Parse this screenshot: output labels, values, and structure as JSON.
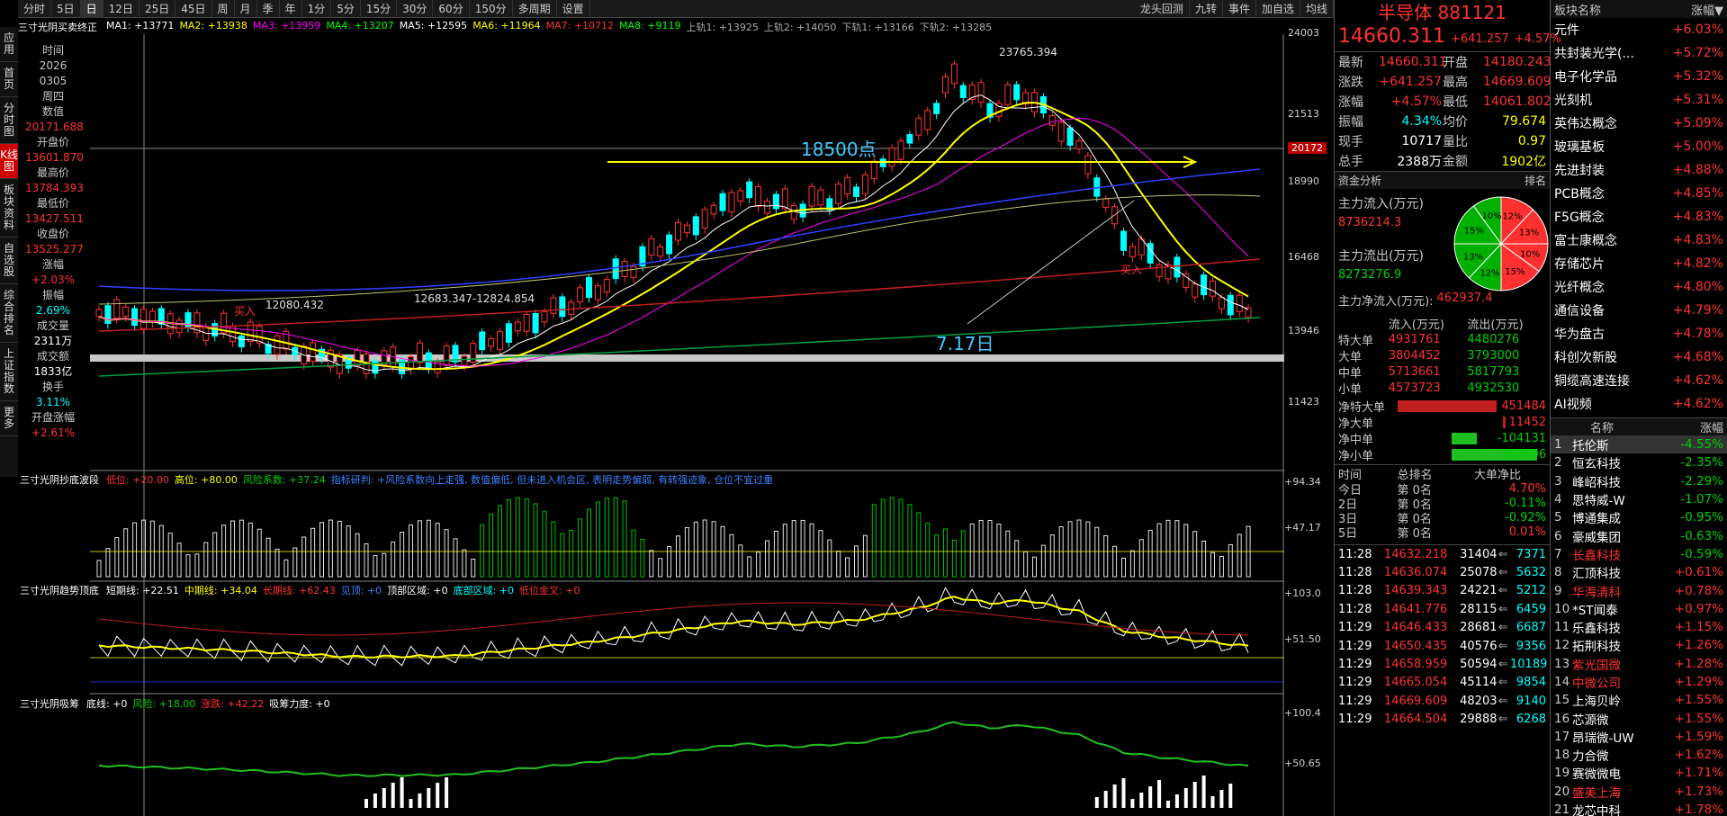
{
  "toolbar": {
    "periods": [
      "分时",
      "5日",
      "日",
      "12日",
      "25日",
      "45日",
      "周",
      "月",
      "季",
      "年",
      "1分",
      "5分",
      "15分",
      "30分",
      "60分",
      "150分",
      "多周期",
      "设置"
    ],
    "active": "日",
    "right_tools": [
      "龙头回测",
      "九转",
      "事件",
      "加自选",
      "均线"
    ]
  },
  "left_nav": [
    "应用",
    "首页",
    "分时图",
    "K线图",
    "板块资料",
    "自选股",
    "综合排名",
    "上证指数",
    "更多"
  ],
  "indicator_title": "三寸光阴买卖终正",
  "ma_labels": [
    {
      "t": "MA1: +13771",
      "c": "#ffffff"
    },
    {
      "t": "MA2: +13938",
      "c": "#ffff00"
    },
    {
      "t": "MA3: +13959",
      "c": "#ff00ff"
    },
    {
      "t": "MA4: +13207",
      "c": "#00ff00"
    },
    {
      "t": "MA5: +12595",
      "c": "#ffffff"
    },
    {
      "t": "MA6: +11964",
      "c": "#ffff00"
    },
    {
      "t": "MA7: +10712",
      "c": "#ff3232"
    },
    {
      "t": "MA8: +9119",
      "c": "#00ff00"
    },
    {
      "t": "上轨1: +13925",
      "c": "#aaaaaa"
    },
    {
      "t": "上轨2: +14050",
      "c": "#aaaaaa"
    },
    {
      "t": "下轨1: +13166",
      "c": "#aaaaaa"
    },
    {
      "t": "下轨2: +13285",
      "c": "#aaaaaa"
    }
  ],
  "info_panel": [
    {
      "k": "时间",
      "v": "2026"
    },
    {
      "k": "",
      "v": "0305"
    },
    {
      "k": "",
      "v": "周四"
    },
    {
      "k": "数值",
      "v": "20171.688",
      "c": "red"
    },
    {
      "k": "开盘价",
      "v": "13601.870",
      "c": "red"
    },
    {
      "k": "最高价",
      "v": "13784.393",
      "c": "red"
    },
    {
      "k": "最低价",
      "v": "13427.511",
      "c": "red"
    },
    {
      "k": "收盘价",
      "v": "13525.277",
      "c": "red"
    },
    {
      "k": "涨幅",
      "v": "+2.03%",
      "c": "red"
    },
    {
      "k": "振幅",
      "v": "2.69%",
      "c": "cyan"
    },
    {
      "k": "成交量",
      "v": "2311万",
      "c": "white"
    },
    {
      "k": "成交额",
      "v": "1833亿",
      "c": "white"
    },
    {
      "k": "换手",
      "v": "3.11%",
      "c": "cyan"
    },
    {
      "k": "开盘涨幅",
      "v": "+2.61%",
      "c": "red"
    }
  ],
  "main_axis": [
    "24003",
    "21513",
    "20172",
    "18990",
    "16468",
    "13946",
    "11423"
  ],
  "annotations": {
    "level": "18500点",
    "date": "7.17日",
    "high": "23765.394",
    "low": "12080.432",
    "low2": "12683.347-12824.854",
    "buy": "买入"
  },
  "sub1": {
    "title": "三寸光阴抄底波段",
    "items": [
      {
        "t": "低位: +20.00",
        "c": "#ff3232"
      },
      {
        "t": "高位: +80.00",
        "c": "#ffff00"
      },
      {
        "t": "风险系数: +37.24",
        "c": "#00d000"
      },
      {
        "t": "指标研判: +风险系数向上走强, 数值偏低, 但未进入机会区, 表明走势偏弱, 有转强迹象, 仓位不宜过重",
        "c": "#4080ff"
      }
    ],
    "axis": [
      "+94.34",
      "+47.17"
    ]
  },
  "sub2": {
    "title": "三寸光阴趋势顶底",
    "items": [
      {
        "t": "短期线: +22.51",
        "c": "#ffffff"
      },
      {
        "t": "中期线: +34.04",
        "c": "#ffff00"
      },
      {
        "t": "长期线: +62.43",
        "c": "#ff3232"
      },
      {
        "t": "见顶: +0",
        "c": "#4080ff"
      },
      {
        "t": "顶部区域: +0",
        "c": "#ffffff"
      },
      {
        "t": "底部区域: +0",
        "c": "#00ffff"
      },
      {
        "t": "低位金叉: +0",
        "c": "#ff3232"
      }
    ],
    "axis": [
      "+103.0",
      "+51.50"
    ]
  },
  "sub3": {
    "title": "三寸光阴吸筹",
    "items": [
      {
        "t": "底线: +0",
        "c": "#ffffff"
      },
      {
        "t": "风险: +18.00",
        "c": "#00d000"
      },
      {
        "t": "涨跌: +42.22",
        "c": "#ff3232"
      },
      {
        "t": "吸筹力度: +0",
        "c": "#ffffff"
      }
    ],
    "axis": [
      "+100.4",
      "+50.65"
    ]
  },
  "quote": {
    "name": "半导体 881121",
    "price": "14660.311",
    "chg": "+641.257",
    "pct": "+4.57%",
    "rows": [
      [
        "最新",
        "14660.311",
        "开盘",
        "14180.243"
      ],
      [
        "涨跌",
        "+641.257",
        "最高",
        "14669.609"
      ],
      [
        "涨幅",
        "+4.57%",
        "最低",
        "14061.802"
      ],
      [
        "振幅",
        "4.34%",
        "均价",
        "79.674"
      ],
      [
        "现手",
        "10717",
        "量比",
        "0.97"
      ],
      [
        "总手",
        "2388万",
        "金额",
        "1902亿"
      ]
    ]
  },
  "fund": {
    "title": "资金分析",
    "rank": "排名",
    "in_label": "主力流入(万元)",
    "in_val": "8736214.3",
    "out_label": "主力流出(万元)",
    "out_val": "8273276.9",
    "net_label": "主力净流入(万元):",
    "net_val": "462937.4",
    "pie": [
      {
        "v": "12%",
        "c": "#ff3030"
      },
      {
        "v": "13%",
        "c": "#ff3030"
      },
      {
        "v": "10%",
        "c": "#ff3030"
      },
      {
        "v": "15%",
        "c": "#ff3030"
      },
      {
        "v": "12%",
        "c": "#00b000"
      },
      {
        "v": "13%",
        "c": "#00b000"
      },
      {
        "v": "15%",
        "c": "#00b000"
      },
      {
        "v": "10%",
        "c": "#00b000"
      }
    ],
    "hdr": [
      "流入(万元)",
      "流出(万元)"
    ],
    "orders": [
      [
        "特大单",
        "4931761",
        "4480276"
      ],
      [
        "大单",
        "3804452",
        "3793000"
      ],
      [
        "中单",
        "5713661",
        "5817793"
      ],
      [
        "小单",
        "4573723",
        "4932530"
      ]
    ],
    "net": [
      [
        "净特大单",
        "451484"
      ],
      [
        "净大单",
        "11452"
      ],
      [
        "净中单",
        "-104131"
      ],
      [
        "净小单",
        "-358806"
      ]
    ],
    "rank_hdr": [
      "时间",
      "总排名",
      "大单净比"
    ],
    "ranks": [
      [
        "今日",
        "第 0名",
        "4.70%"
      ],
      [
        "2日",
        "第 0名",
        "-0.11%"
      ],
      [
        "3日",
        "第 0名",
        "-0.92%"
      ],
      [
        "5日",
        "第 0名",
        "0.01%"
      ]
    ]
  },
  "ticks": [
    [
      "11:28",
      "14632.218",
      "31404",
      "7371"
    ],
    [
      "11:28",
      "14636.074",
      "25078",
      "5632"
    ],
    [
      "11:28",
      "14639.343",
      "24221",
      "5212"
    ],
    [
      "11:28",
      "14641.776",
      "28115",
      "6459"
    ],
    [
      "11:29",
      "14646.433",
      "28681",
      "6687"
    ],
    [
      "11:29",
      "14650.435",
      "40576",
      "9356"
    ],
    [
      "11:29",
      "14658.959",
      "50594",
      "10189"
    ],
    [
      "11:29",
      "14665.054",
      "45114",
      "9854"
    ],
    [
      "11:29",
      "14669.609",
      "48203",
      "9140"
    ],
    [
      "11:29",
      "14664.504",
      "29888",
      "6268"
    ]
  ],
  "sectors": {
    "hdr": [
      "板块名称",
      "涨幅▼"
    ],
    "rows": [
      [
        "元件",
        "+6.03%"
      ],
      [
        "共封装光学(...",
        "+5.72%"
      ],
      [
        "电子化学品",
        "+5.32%"
      ],
      [
        "光刻机",
        "+5.31%"
      ],
      [
        "英伟达概念",
        "+5.09%"
      ],
      [
        "玻璃基板",
        "+5.00%"
      ],
      [
        "先进封装",
        "+4.88%"
      ],
      [
        "PCB概念",
        "+4.85%"
      ],
      [
        "F5G概念",
        "+4.83%"
      ],
      [
        "富士康概念",
        "+4.83%"
      ],
      [
        "存储芯片",
        "+4.82%"
      ],
      [
        "光纤概念",
        "+4.80%"
      ],
      [
        "通信设备",
        "+4.79%"
      ],
      [
        "华为盘古",
        "+4.78%"
      ],
      [
        "科创次新股",
        "+4.68%"
      ],
      [
        "铜缆高速连接",
        "+4.62%"
      ],
      [
        "AI视频",
        "+4.62%"
      ]
    ]
  },
  "stocks": {
    "hdr": [
      "名称",
      "涨幅"
    ],
    "rows": [
      [
        "1",
        "托伦斯",
        "-4.55%",
        "#ffffff"
      ],
      [
        "2",
        "恒玄科技",
        "-2.35%",
        "#ffffff"
      ],
      [
        "3",
        "峰岹科技",
        "-2.29%",
        "#ffffff"
      ],
      [
        "4",
        "思特威-W",
        "-1.07%",
        "#ffffff"
      ],
      [
        "5",
        "博通集成",
        "-0.95%",
        "#ffffff"
      ],
      [
        "6",
        "豪威集团",
        "-0.63%",
        "#ffffff"
      ],
      [
        "7",
        "长鑫科技",
        "-0.59%",
        "#ff3232"
      ],
      [
        "8",
        "汇顶科技",
        "+0.61%",
        "#ffffff"
      ],
      [
        "9",
        "华海清科",
        "+0.78%",
        "#ff3232"
      ],
      [
        "10",
        "*ST闻泰",
        "+0.97%",
        "#ffffff"
      ],
      [
        "11",
        "乐鑫科技",
        "+1.15%",
        "#ffffff"
      ],
      [
        "12",
        "拓荆科技",
        "+1.26%",
        "#ffffff"
      ],
      [
        "13",
        "紫光国微",
        "+1.28%",
        "#ff3232"
      ],
      [
        "14",
        "中微公司",
        "+1.29%",
        "#ff3232"
      ],
      [
        "15",
        "上海贝岭",
        "+1.55%",
        "#ffffff"
      ],
      [
        "16",
        "芯源微",
        "+1.55%",
        "#ffffff"
      ],
      [
        "17",
        "昂瑞微-UW",
        "+1.59%",
        "#ffffff"
      ],
      [
        "18",
        "力合微",
        "+1.62%",
        "#ffffff"
      ],
      [
        "19",
        "赛微微电",
        "+1.71%",
        "#ffffff"
      ],
      [
        "20",
        "盛美上海",
        "+1.73%",
        "#ff3232"
      ],
      [
        "21",
        "龙芯中科",
        "+1.78%",
        "#ffffff"
      ]
    ]
  }
}
